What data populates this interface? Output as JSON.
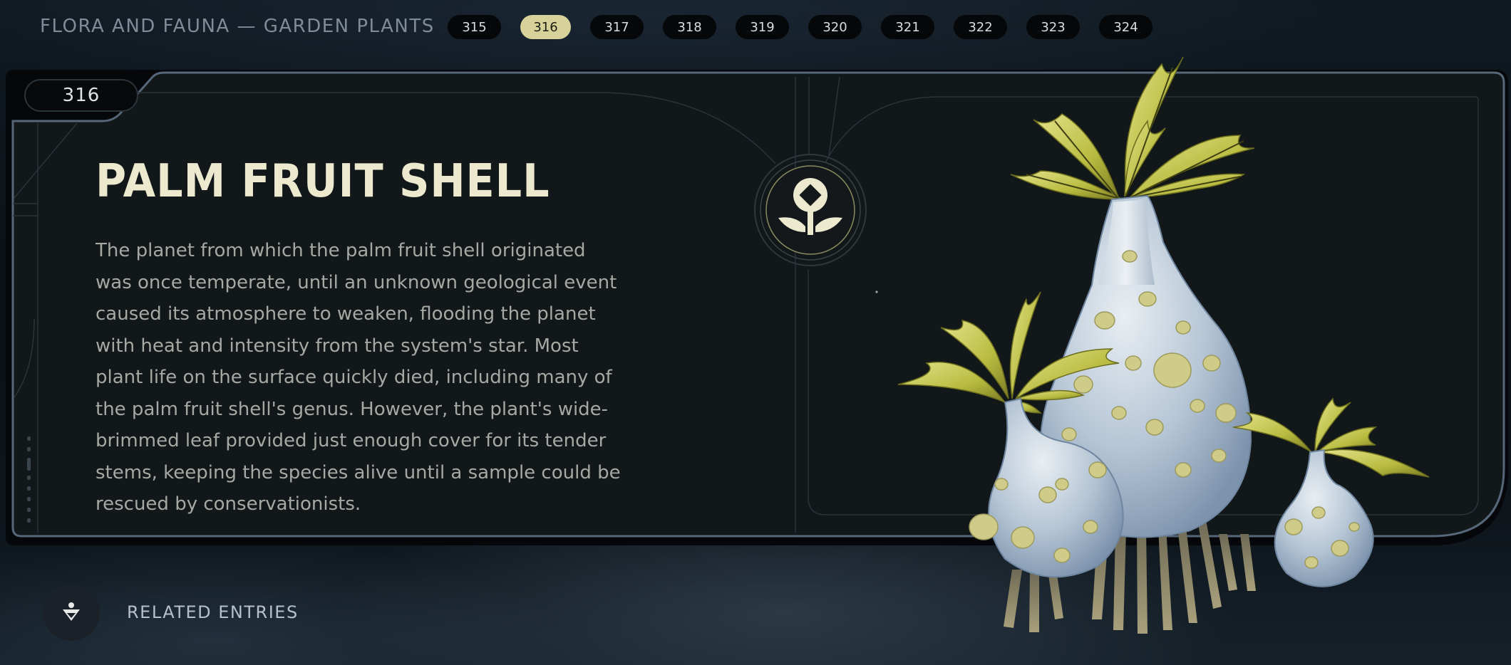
{
  "header": {
    "breadcrumb": "FLORA AND FAUNA — GARDEN PLANTS",
    "pages": [
      "315",
      "316",
      "317",
      "318",
      "319",
      "320",
      "321",
      "322",
      "323",
      "324"
    ],
    "active_page": "316"
  },
  "entry": {
    "number": "316",
    "title": "PALM FRUIT SHELL",
    "description": "The planet from which the palm fruit shell originated was once temperate, until an unknown geological event caused its atmosphere to weaken, flooding the planet with heat and intensity from the system's star. Most plant life on the surface quickly died, including many of the palm fruit shell's genus. However, the plant's wide-brimmed leaf provided just enough cover for its tender stems, keeping the species alive until a sample could be rescued by conservationists.",
    "category_icon": "plant-emblem-icon"
  },
  "footer": {
    "related_label": "RELATED ENTRIES",
    "related_icon": "related-entries-icon"
  },
  "colors": {
    "accent": "#d6d29a",
    "title": "#ece9cf",
    "body_text": "#a6a9a3",
    "panel_border": "#4a5a6a"
  }
}
